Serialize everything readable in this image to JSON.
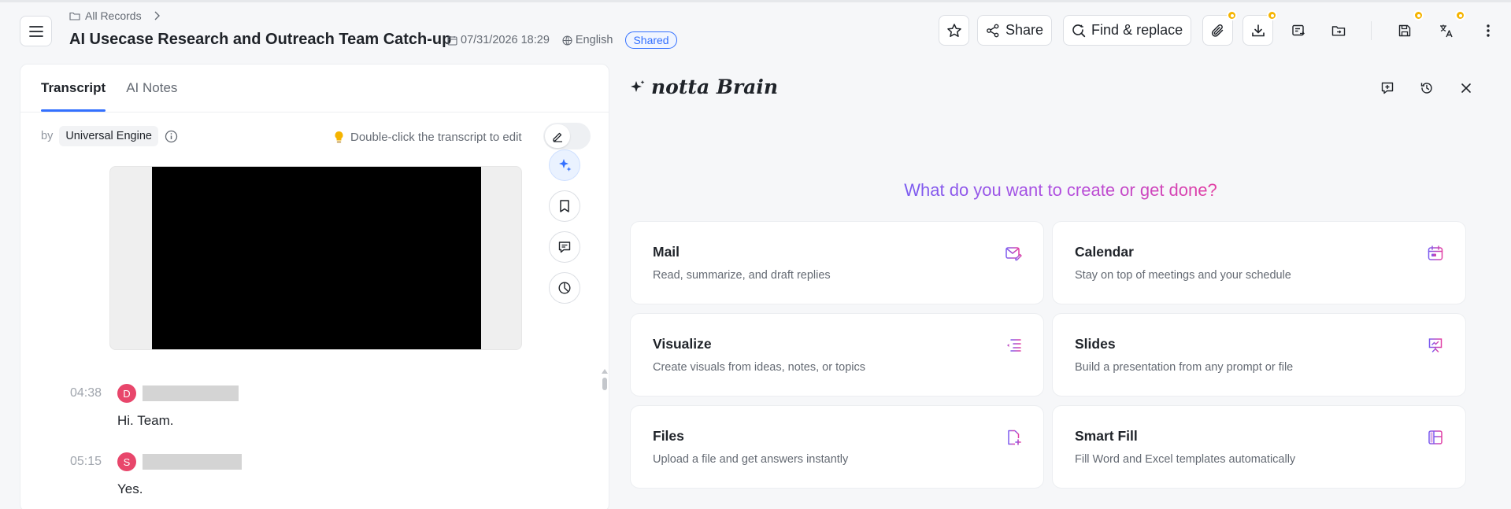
{
  "header": {
    "breadcrumb": "All Records",
    "title": "AI Usecase Research and Outreach Team Catch-up",
    "datetime": "07/31/2026 18:29",
    "language": "English",
    "shared_badge": "Shared",
    "share_label": "Share",
    "find_replace_label": "Find & replace"
  },
  "transcript_panel": {
    "tabs": [
      {
        "label": "Transcript",
        "active": true
      },
      {
        "label": "AI Notes",
        "active": false
      }
    ],
    "by_label": "by",
    "engine": "Universal Engine",
    "edit_hint": "Double-click the transcript to edit",
    "segments": [
      {
        "time": "04:38",
        "initial": "D",
        "text": "Hi. Team."
      },
      {
        "time": "05:15",
        "initial": "S",
        "text": "Yes."
      }
    ]
  },
  "brain_panel": {
    "brand": "notta Brain",
    "question": "What do you want to create or get done?",
    "cards": [
      {
        "title": "Mail",
        "desc": "Read, summarize, and draft replies",
        "icon": "mail-edit-icon"
      },
      {
        "title": "Calendar",
        "desc": "Stay on top of meetings and your schedule",
        "icon": "calendar-icon"
      },
      {
        "title": "Visualize",
        "desc": "Create visuals from ideas, notes, or topics",
        "icon": "list-tree-icon"
      },
      {
        "title": "Slides",
        "desc": "Build a presentation from any prompt or file",
        "icon": "presentation-icon"
      },
      {
        "title": "Files",
        "desc": "Upload a file and get answers instantly",
        "icon": "file-plus-icon"
      },
      {
        "title": "Smart Fill",
        "desc": "Fill Word and Excel templates automatically",
        "icon": "layout-icon"
      }
    ]
  },
  "colors": {
    "accent": "#3370ff",
    "brand_gradient_start": "#7b5cf0",
    "brand_gradient_end": "#e23fa3",
    "badge_dot": "#f5b400",
    "avatar": "#e8466b"
  }
}
